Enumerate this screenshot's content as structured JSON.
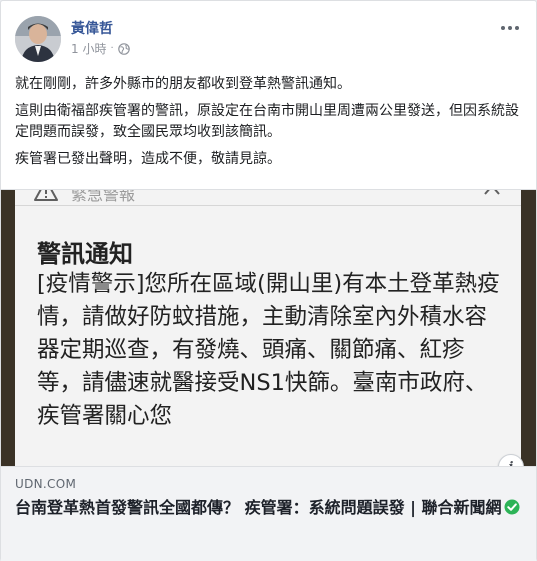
{
  "post": {
    "author_name": "黃偉哲",
    "timestamp": "1 小時",
    "separator": "·",
    "paragraphs": [
      "就在剛剛，許多外縣市的朋友都收到登革熱警訊通知。",
      "這則由衛福部疾管署的警訊，原設定在台南市開山里周遭兩公里發送，但因系統設定問題而誤發，致全國民眾均收到該簡訊。",
      "疾管署已發出聲明，造成不便，敬請見諒。"
    ]
  },
  "attachment": {
    "alert_header_label": "緊急警報",
    "alert_title": "警訊通知",
    "alert_body": "[疫情警示]您所在區域(開山里)有本土登革熱疫情，請做好防蚊措施，主動清除室內外積水容器定期巡查，有發燒、頭痛、關節痛、紅疹等，請儘速就醫接受NS1快篩。臺南市政府、疾管署關心您",
    "info_label": "i",
    "domain": "UDN.COM",
    "title": "台南登革熱首發警訊全國都傳？ 疾管署：系統問題誤發 | 聯合新聞網"
  },
  "icons": {
    "globe": "globe-icon",
    "more": "more-options-icon",
    "warning": "warning-triangle-icon",
    "chevron": "chevron-up-icon",
    "verified": "verified-check-icon"
  },
  "colors": {
    "author_link": "#385898",
    "verified": "#2db357",
    "meta_text": "#90949c"
  }
}
